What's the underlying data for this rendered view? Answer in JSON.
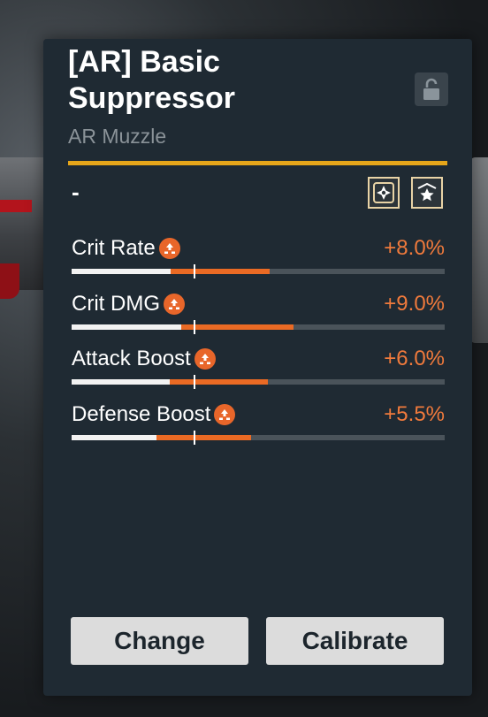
{
  "item": {
    "title_line1": "[AR] Basic",
    "title_line2": "Suppressor",
    "category": "AR Muzzle",
    "lock_icon": "unlocked-padlock-icon",
    "rarity_color": "#e6a61a"
  },
  "set_effect": {
    "text": "-",
    "badges": [
      "compass-star-badge-icon",
      "star-rank-badge-icon"
    ]
  },
  "stats": [
    {
      "name": "Crit Rate",
      "value": "+8.0%",
      "icon": "upgrade-arrow-icon",
      "base_fraction": 0.265,
      "bonus_fraction": 0.265
    },
    {
      "name": "Crit DMG",
      "value": "+9.0%",
      "icon": "upgrade-arrow-icon",
      "base_fraction": 0.295,
      "bonus_fraction": 0.3
    },
    {
      "name": "Attack Boost",
      "value": "+6.0%",
      "icon": "upgrade-arrow-icon",
      "base_fraction": 0.262,
      "bonus_fraction": 0.264
    },
    {
      "name": "Defense Boost",
      "value": "+5.5%",
      "icon": "upgrade-arrow-icon",
      "base_fraction": 0.228,
      "bonus_fraction": 0.254
    }
  ],
  "actions": {
    "change": "Change",
    "calibrate": "Calibrate"
  },
  "colors": {
    "panel": "#1f2a33",
    "accent_orange": "#ea6a24",
    "value_orange": "#f07a3c",
    "button_bg": "#dcdcdc"
  }
}
